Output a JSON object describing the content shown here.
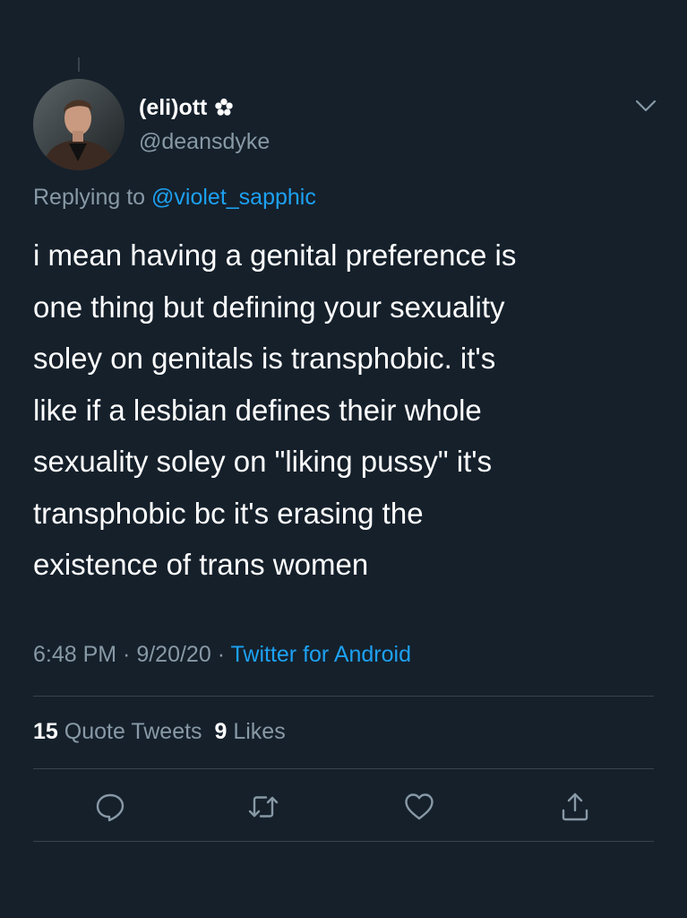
{
  "tweet": {
    "display_name": "(eli)ott",
    "handle": "@deansdyke",
    "replying_prefix": "Replying to ",
    "replying_to": "@violet_sapphic",
    "text": "i mean having a genital preference is\none thing but defining your sexuality\nsoley on genitals is transphobic. it's\nlike if a lesbian defines their whole\nsexuality soley on \"liking pussy\" it's\ntransphobic bc it's erasing the\nexistence of trans women",
    "time": "6:48 PM",
    "date": "9/20/20",
    "separator": " · ",
    "source": "Twitter for Android"
  },
  "stats": {
    "quote_count": "15",
    "quote_label": "Quote Tweets",
    "like_count": "9",
    "like_label": "Likes"
  },
  "icons": {
    "name_badge": "flower-icon",
    "menu": "chevron-down-icon",
    "actions": [
      "reply-icon",
      "retweet-icon",
      "like-icon",
      "share-icon"
    ]
  },
  "colors": {
    "background": "#15202b",
    "text": "#ffffff",
    "secondary": "#8899a6",
    "accent": "#1da1f2",
    "divider": "#38444d"
  }
}
